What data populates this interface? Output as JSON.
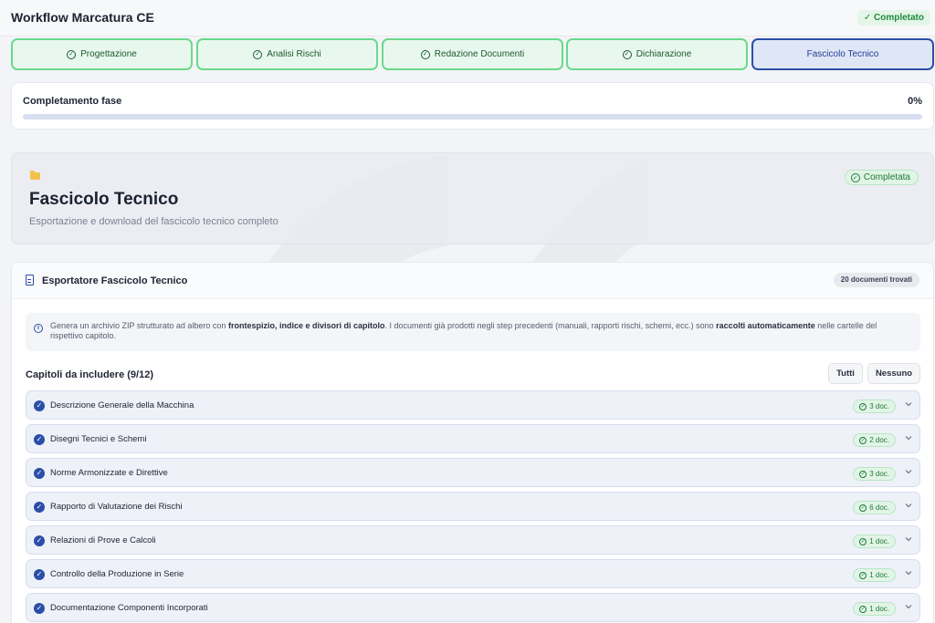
{
  "header": {
    "title": "Workflow Marcatura CE",
    "status": "✓ Completato"
  },
  "steps": [
    {
      "label": "Progettazione",
      "state": "done"
    },
    {
      "label": "Analisi Rischi",
      "state": "done"
    },
    {
      "label": "Redazione Documenti",
      "state": "done"
    },
    {
      "label": "Dichiarazione",
      "state": "done"
    },
    {
      "label": "Fascicolo Tecnico",
      "state": "active"
    }
  ],
  "progress": {
    "label": "Completamento fase",
    "value_text": "0%",
    "value": 0
  },
  "hero": {
    "title": "Fascicolo Tecnico",
    "subtitle": "Esportazione e download del fascicolo tecnico completo",
    "badge": "Completata",
    "folder_icon": "folder-icon"
  },
  "exporter": {
    "title": "Esportatore Fascicolo Tecnico",
    "count": "20 documenti trovati",
    "info": {
      "p1": "Genera un archivio ZIP strutturato ad albero con ",
      "b1": "frontespizio, indice e divisori di capitolo",
      "p2": ". I documenti già prodotti negli step precedenti (manuali, rapporti rischi, schemi, ecc.) sono ",
      "b2": "raccolti automaticamente",
      "p3": " nelle cartelle del rispettivo capitolo."
    },
    "chapters_title": "Capitoli da includere (9/12)",
    "btn_all": "Tutti",
    "btn_none": "Nessuno",
    "chapters": [
      {
        "name": "Descrizione Generale della Macchina",
        "docs": "3 doc."
      },
      {
        "name": "Disegni Tecnici e Schemi",
        "docs": "2 doc."
      },
      {
        "name": "Norme Armonizzate e Direttive",
        "docs": "3 doc."
      },
      {
        "name": "Rapporto di Valutazione dei Rischi",
        "docs": "6 doc."
      },
      {
        "name": "Relazioni di Prove e Calcoli",
        "docs": "1 doc."
      },
      {
        "name": "Controllo della Produzione in Serie",
        "docs": "1 doc."
      },
      {
        "name": "Documentazione Componenti Incorporati",
        "docs": "1 doc."
      }
    ]
  },
  "colors": {
    "accent": "#2b4fa8",
    "success": "#1f7a3a",
    "success_bg": "#e1f5e6",
    "folder": "#f3c14b"
  }
}
